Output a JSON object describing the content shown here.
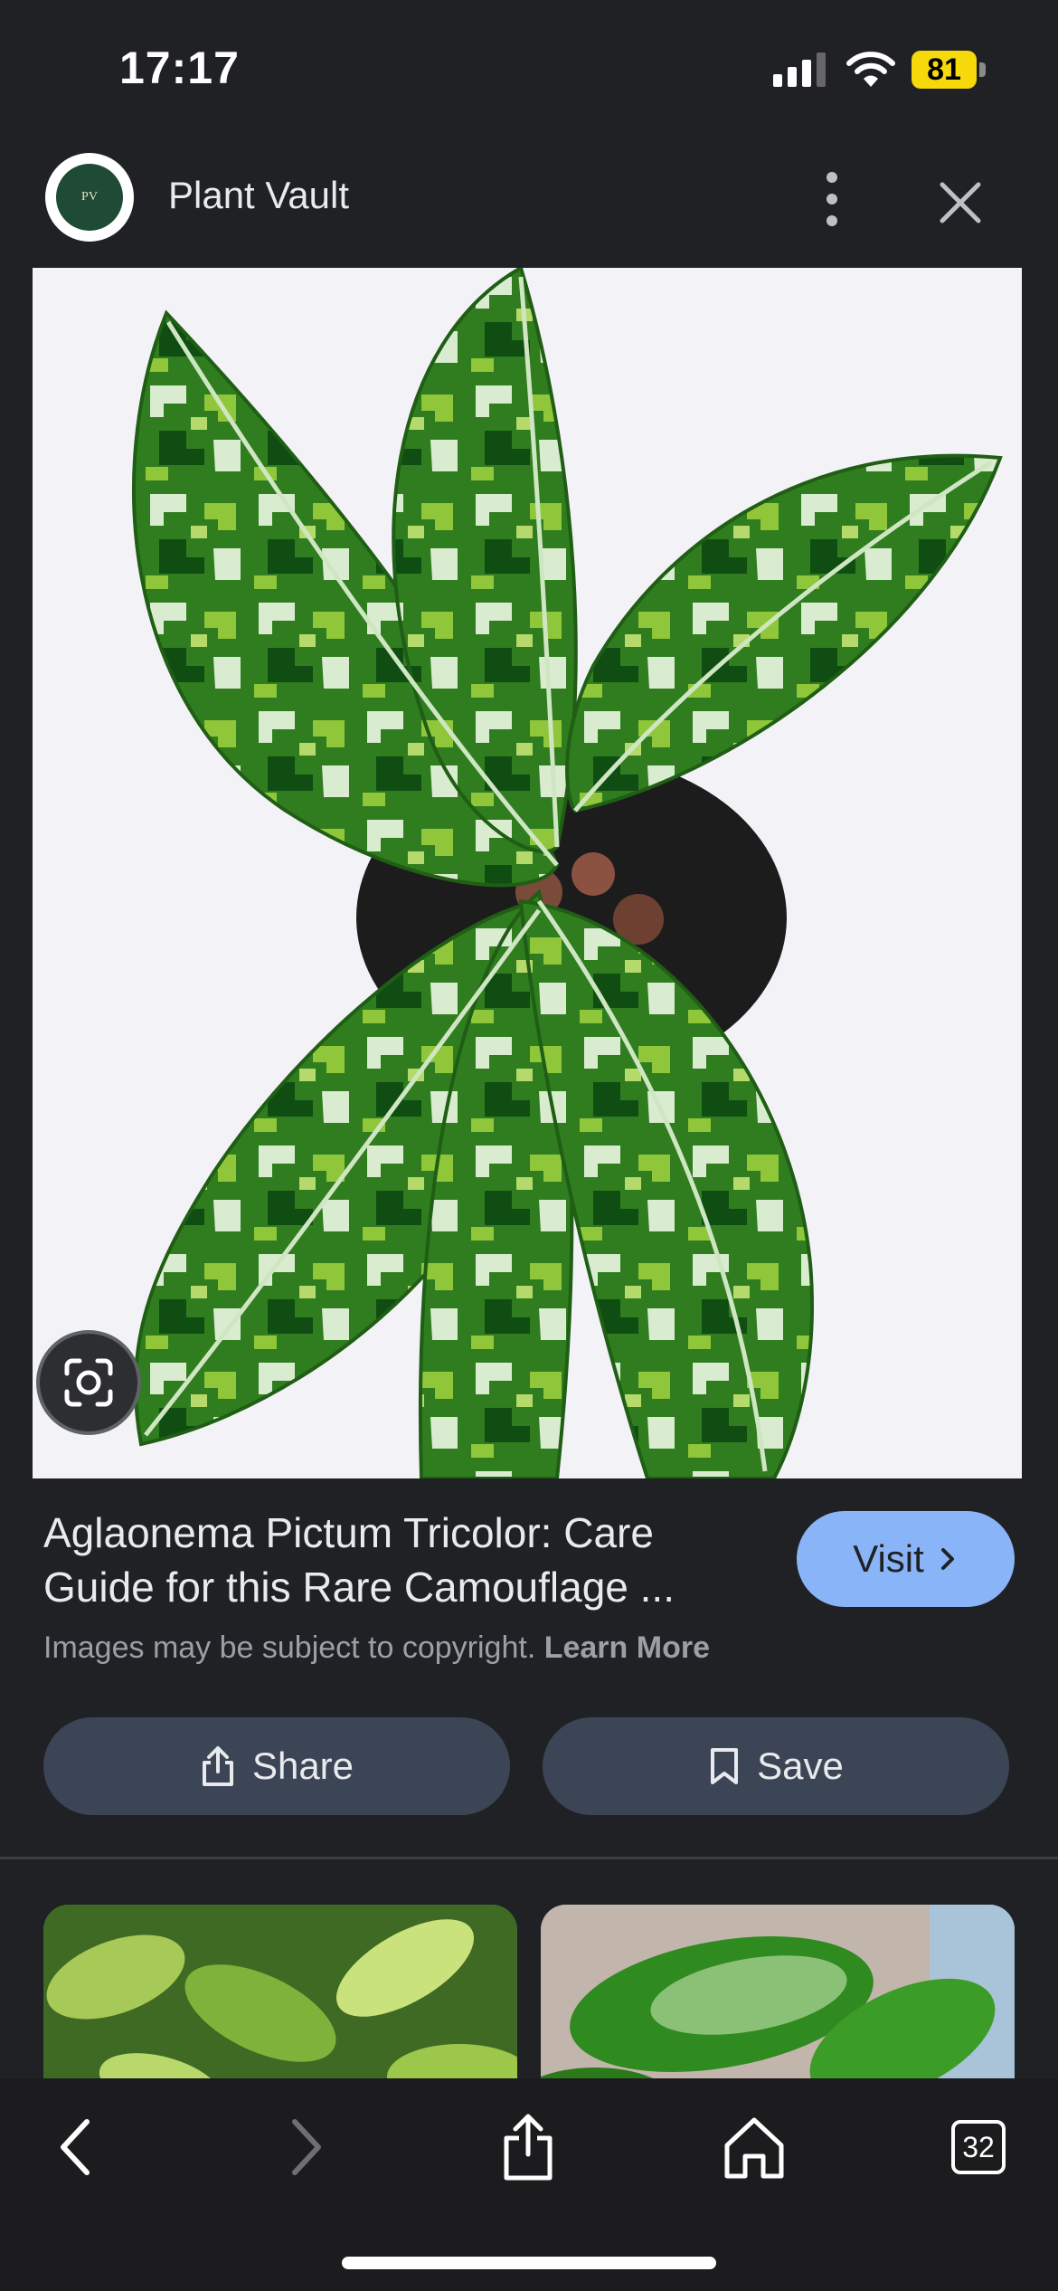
{
  "status_bar": {
    "time": "17:17",
    "battery": "81",
    "battery_color": "#f5d90a"
  },
  "header": {
    "site_name": "Plant Vault",
    "logo_text": "PLANT VAULT",
    "more_icon": "more-vert-icon",
    "close_icon": "close-icon"
  },
  "result": {
    "title": "Aglaonema Pictum Tricolor: Care Guide for this Rare Camouflage ...",
    "copyright_text": "Images may be subject to copyright.",
    "learn_more": "Learn More",
    "visit_label": "Visit",
    "share_label": "Share",
    "save_label": "Save",
    "accent_color": "#8ab4f8"
  },
  "toolbar": {
    "tabs_count": "32",
    "icons": [
      "back-icon",
      "forward-icon",
      "share-icon",
      "home-icon",
      "tabs-icon"
    ]
  }
}
